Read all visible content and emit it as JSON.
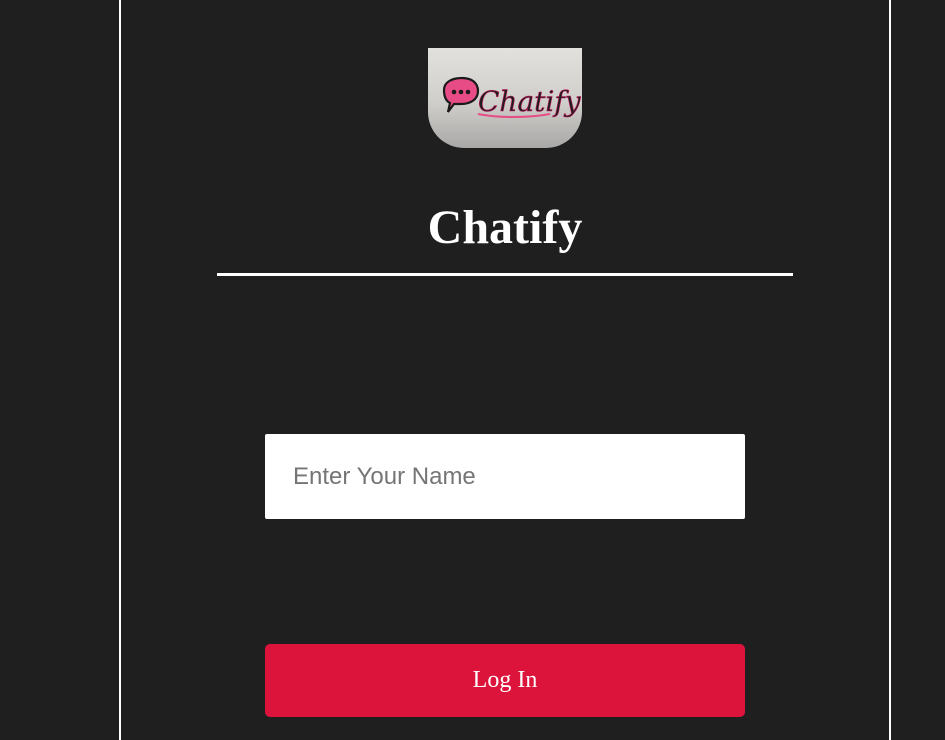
{
  "app": {
    "logo_text": "Chatify",
    "title": "Chatify"
  },
  "form": {
    "name_placeholder": "Enter Your Name",
    "name_value": "",
    "login_label": "Log In"
  },
  "colors": {
    "background": "#201f20",
    "accent": "#dc143c",
    "border": "#ffffff"
  }
}
